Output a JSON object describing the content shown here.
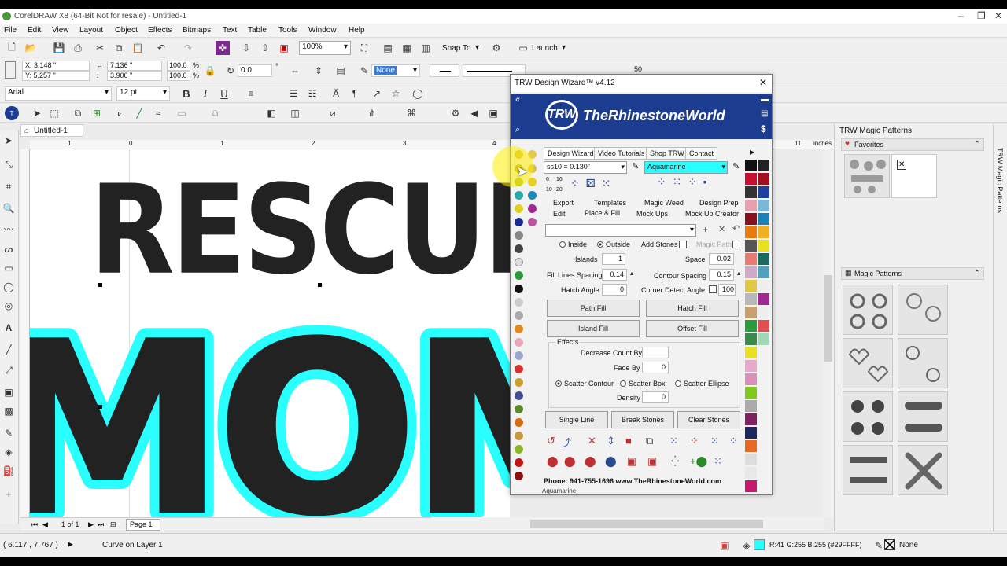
{
  "app": {
    "title": "CorelDRAW X8 (64-Bit Not for resale) - Untitled-1",
    "doc_tab": "Untitled-1"
  },
  "menu": [
    "File",
    "Edit",
    "View",
    "Layout",
    "Object",
    "Effects",
    "Bitmaps",
    "Text",
    "Table",
    "Tools",
    "Window",
    "Help"
  ],
  "standard_toolbar": {
    "zoom": "100%",
    "snap_to": "Snap To",
    "launch": "Launch"
  },
  "property_bar": {
    "x": "X: 3.148 \"",
    "y": "Y: 5.257 \"",
    "w": "7.136 \"",
    "h": "3.906 \"",
    "scale_x": "100.0",
    "scale_y": "100.0",
    "pct": "%",
    "angle": "0.0",
    "fill": "None",
    "outline_num": "50"
  },
  "text_bar": {
    "font": "Arial",
    "size": "12 pt"
  },
  "canvas": {
    "text_top": "RESCUE",
    "text_main": "MOM",
    "ruler_labels": [
      "1",
      "0",
      "1",
      "2",
      "3",
      "4"
    ],
    "ruler_right_label": "11",
    "ruler_unit": "inches"
  },
  "page_nav": {
    "page_of": "1 of 1",
    "page_tab": "Page 1"
  },
  "status": {
    "coords": "( 6.117 , 7.767 )",
    "object_info": "Curve on Layer 1",
    "fill_color_info": "R:41 G:255 B:255 (#29FFFF)",
    "outline_info": "None",
    "fill_color": "#29ffff"
  },
  "trw": {
    "title": "TRW Design Wizard™ v4.12",
    "brand_logo": "TRW",
    "brand": "TheRhinestoneWorld",
    "tabs": [
      "Design Wizard",
      "Video Tutorials",
      "Shop TRW",
      "Contact"
    ],
    "stone_size": "ss10 = 0.130\"",
    "stone_color": "Aquamarine",
    "size_labels": [
      "6",
      "16",
      "10",
      "20"
    ],
    "links_row1": [
      "Export",
      "Templates",
      "Magic Weed",
      "Design Prep"
    ],
    "links_row2": [
      "Edit",
      "Place & Fill",
      "Mock Ups",
      "Mock Up Creator"
    ],
    "inside": "Inside",
    "outside": "Outside",
    "add_stones": "Add Stones",
    "magic_path": "Magic Path",
    "islands_label": "Islands",
    "islands": "1",
    "space_label": "Space",
    "space": "0.02",
    "fill_lines_label": "Fill Lines Spacing",
    "fill_lines": "0.14",
    "contour_label": "Contour Spacing",
    "contour": "0.15",
    "hatch_label": "Hatch Angle",
    "hatch": "0",
    "corner_label": "Corner Detect Angle",
    "corner": "100",
    "buttons": [
      "Path Fill",
      "Hatch Fill",
      "Island Fill",
      "Offset Fill"
    ],
    "effects_title": "Effects",
    "decrease_label": "Decrease Count By",
    "decrease": "",
    "fade_label": "Fade By",
    "fade": "0",
    "scatter": [
      "Scatter Contour",
      "Scatter Box",
      "Scatter Ellipse"
    ],
    "density_label": "Density",
    "density": "0",
    "bottom_buttons": [
      "Single Line",
      "Break Stones",
      "Clear Stones"
    ],
    "footer": "Phone: 941-755-1696  www.TheRhinestoneWorld.com",
    "footer_color": "Aquamarine",
    "accent": "#1c3c90"
  },
  "magic_panel": {
    "header": "TRW Magic Patterns",
    "favorites": "Favorites",
    "patterns": "Magic Patterns",
    "dock_label": "TRW Magic Patterns"
  }
}
